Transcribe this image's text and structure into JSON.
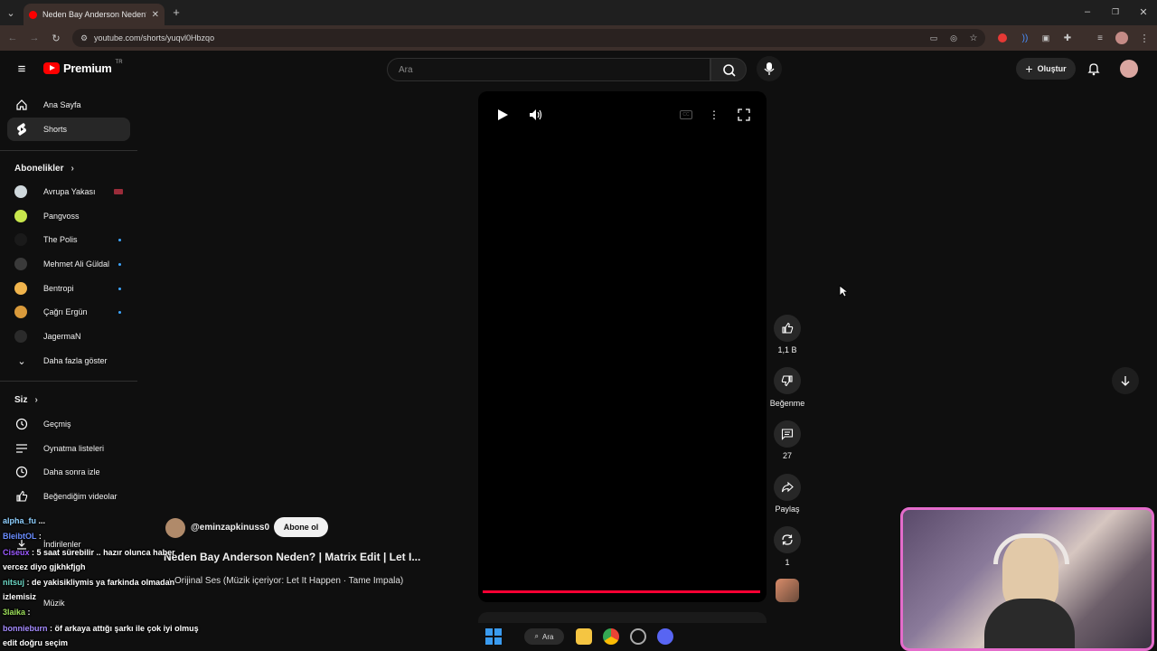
{
  "browser": {
    "tab_title": "Neden Bay Anderson Neden? |",
    "new_tab_icon": "plus-icon",
    "url": "youtube.com/shorts/yuqvl0Hbzqo"
  },
  "header": {
    "logo_text": "Premium",
    "logo_region": "TR",
    "search_placeholder": "Ara",
    "create_label": "Oluştur"
  },
  "sidebar": {
    "main": [
      {
        "label": "Ana Sayfa",
        "icon": "home-icon"
      },
      {
        "label": "Shorts",
        "icon": "shorts-icon"
      }
    ],
    "subscriptions_title": "Abonelikler",
    "subscriptions": [
      {
        "label": "Avrupa Yakası",
        "color": "#cfd8dc"
      },
      {
        "label": "Pangvoss",
        "color": "#c8e64c"
      },
      {
        "label": "The Polis",
        "color": "#1a1a1a"
      },
      {
        "label": "Mehmet Ali Güldal",
        "color": "#3a3a3a"
      },
      {
        "label": "Bentropi",
        "color": "#f0b44c"
      },
      {
        "label": "Çağrı Ergün",
        "color": "#d99a3b"
      },
      {
        "label": "JagermaN",
        "color": "#2b2b2b"
      }
    ],
    "show_more": "Daha fazla göster",
    "you_title": "Siz",
    "you": [
      {
        "label": "Geçmiş",
        "icon": "history-icon"
      },
      {
        "label": "Oynatma listeleri",
        "icon": "playlist-icon"
      },
      {
        "label": "Daha sonra izle",
        "icon": "clock-icon"
      },
      {
        "label": "Beğendiğim videolar",
        "icon": "thumbs-up-icon"
      },
      {
        "label": "İndirilenler",
        "icon": "download-icon"
      },
      {
        "label": "Müzik",
        "icon": "music-icon"
      }
    ]
  },
  "short": {
    "channel": "@eminzapkinuss0",
    "subscribe": "Abone ol",
    "title": "Neden Bay Anderson Neden? | Matrix Edit | Let I...",
    "audio": "Orijinal Ses (Müzik içeriyor: Let It Happen · Tame Impala)",
    "progress": 0.0
  },
  "actions": {
    "likes": "1,1 B",
    "dislike": "Beğenme",
    "comments": "27",
    "share": "Paylaş",
    "remix": "1"
  },
  "chat": [
    {
      "user": "alpha_fu",
      "text": "... ",
      "color": "#8fd0ff",
      "tail": "..."
    },
    {
      "user": "BleibtOL",
      "text": ":",
      "color": "#6a8dff"
    },
    {
      "user": "Ciseux",
      "text": ": 5 saat sürebilir .. hazır olunca haber",
      "color": "#9b59ff"
    },
    {
      "user": "",
      "text": "vercez diyo gjkhkfjgh",
      "color": "#ffffff"
    },
    {
      "user": "nitsuj",
      "text": ": de yakisikliymis ya farkinda olmadan",
      "color": "#6cd6c4"
    },
    {
      "user": "",
      "text": "izlemisiz",
      "color": "#ffffff"
    },
    {
      "user": "3laika",
      "text": ":",
      "color": "#9de05a"
    },
    {
      "user": "bonnieburn",
      "text": ": öf arkaya attığı şarkı ile çok iyi olmuş",
      "color": "#a58bff"
    },
    {
      "user": "",
      "text": "edit doğru seçim",
      "color": "#ffffff"
    }
  ],
  "taskbar": {
    "search_label": "Ara"
  }
}
